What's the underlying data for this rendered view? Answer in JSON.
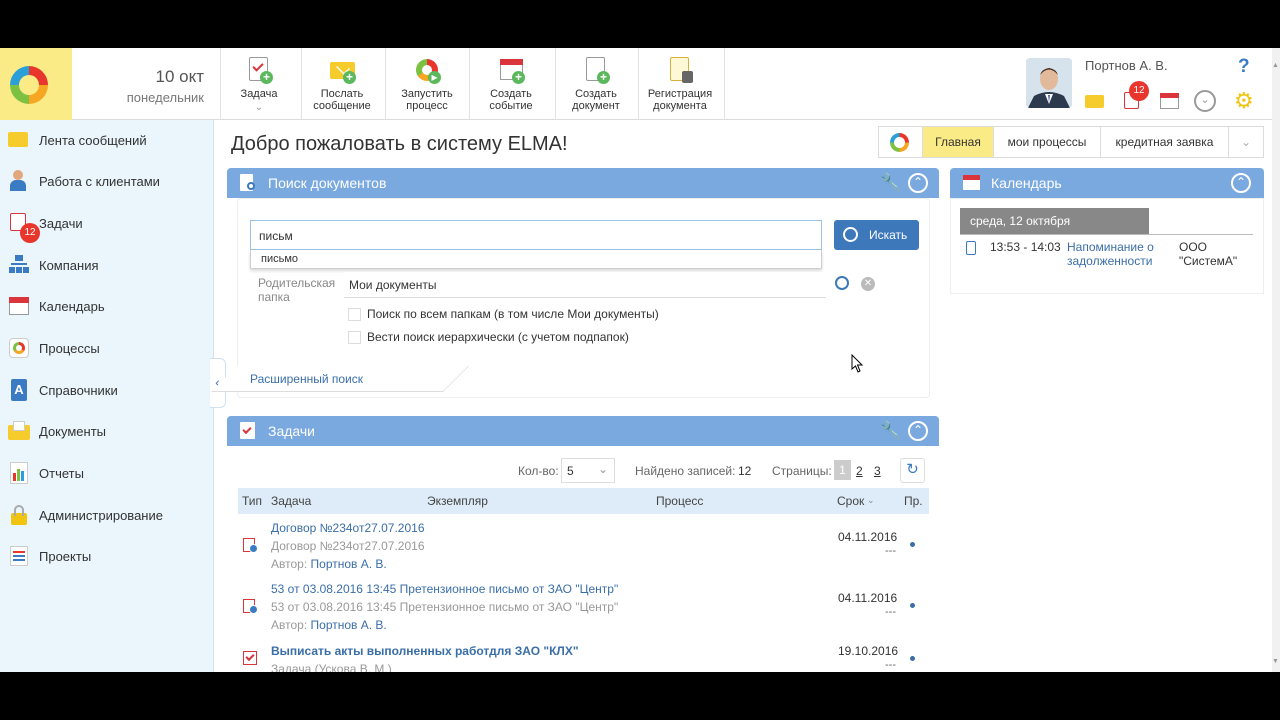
{
  "header": {
    "date_day": "10 окт",
    "date_weekday": "понедельник",
    "toolbar": [
      {
        "label": "Задача",
        "icon": "task-icon",
        "has_dropdown": true
      },
      {
        "label": "Послать сообщение",
        "icon": "envelope-icon"
      },
      {
        "label": "Запустить процесс",
        "icon": "process-icon"
      },
      {
        "label": "Создать событие",
        "icon": "calendar-icon"
      },
      {
        "label": "Создать документ",
        "icon": "document-icon"
      },
      {
        "label": "Регистрация документа",
        "icon": "register-document-icon"
      }
    ],
    "toolbar_labels": {
      "task_l1": "Задача",
      "msg_l1": "Послать",
      "msg_l2": "сообщение",
      "proc_l1": "Запустить",
      "proc_l2": "процесс",
      "event_l1": "Создать",
      "event_l2": "событие",
      "doc_l1": "Создать",
      "doc_l2": "документ",
      "reg_l1": "Регистрация",
      "reg_l2": "документа"
    },
    "user_name": "Портнов А. В.",
    "task_badge": "12",
    "help": "?"
  },
  "sidebar": {
    "items": [
      {
        "label": "Лента сообщений",
        "icon": "feed-icon"
      },
      {
        "label": "Работа с клиентами",
        "icon": "clients-icon"
      },
      {
        "label": "Задачи",
        "icon": "tasks-icon",
        "badge": "12"
      },
      {
        "label": "Компания",
        "icon": "company-icon"
      },
      {
        "label": "Календарь",
        "icon": "calendar-icon"
      },
      {
        "label": "Процессы",
        "icon": "processes-icon"
      },
      {
        "label": "Справочники",
        "icon": "catalogs-icon"
      },
      {
        "label": "Документы",
        "icon": "documents-icon"
      },
      {
        "label": "Отчеты",
        "icon": "reports-icon"
      },
      {
        "label": "Администрирование",
        "icon": "admin-icon"
      },
      {
        "label": "Проекты",
        "icon": "projects-icon"
      }
    ]
  },
  "main": {
    "title": "Добро пожаловать в систему ELMA!",
    "tabs": [
      {
        "label": "Главная",
        "active": true
      },
      {
        "label": "мои процессы"
      },
      {
        "label": "кредитная заявка"
      }
    ]
  },
  "search_panel": {
    "title": "Поиск документов",
    "query": "письм",
    "suggestion": "письмо",
    "search_button": "Искать",
    "folder_label": "Родительская папка",
    "folder_value": "Мои документы",
    "check_all_folders": "Поиск по всем папкам (в том числе Мои документы)",
    "check_hierarchical": "Вести поиск иерархически (с учетом подпапок)",
    "advanced_link": "Расширенный поиск"
  },
  "tasks_panel": {
    "title": "Задачи",
    "count_label": "Кол-во:",
    "count_value": "5",
    "found_label": "Найдено записей:",
    "found_value": "12",
    "pages_label": "Страницы:",
    "pages": [
      "1",
      "2",
      "3"
    ],
    "columns": [
      "Тип",
      "Задача",
      "Экземпляр",
      "Процесс",
      "Срок",
      "Пр."
    ],
    "rows": [
      {
        "title": "Договор №234от27.07.2016",
        "subtitle": "Договор №234от27.07.2016",
        "author_label": "Автор:",
        "author": "Портнов А. В.",
        "due": "04.11.2016",
        "dash": "---"
      },
      {
        "title": "53 от 03.08.2016 13:45 Претензионное письмо от ЗАО \"Центр\"",
        "subtitle": "53 от 03.08.2016 13:45 Претензионное письмо от ЗАО \"Центр\"",
        "author_label": "Автор:",
        "author": "Портнов А. В.",
        "due": "04.11.2016",
        "dash": "---"
      },
      {
        "title": "Выписать акты выполненных работдля ЗАО \"КЛХ\"",
        "subtitle": "Задача (Ускова В. М.)",
        "due": "19.10.2016",
        "dash": "---"
      }
    ]
  },
  "calendar_panel": {
    "title": "Календарь",
    "day": "среда, 12 октября",
    "events": [
      {
        "time": "13:53 - 14:03",
        "title_l1": "Напоминание о",
        "title_l2": "задолженности",
        "org_l1": "ООО",
        "org_l2": "\"СистемА\""
      }
    ]
  },
  "colors": {
    "accent": "#7aa9df",
    "sidebar_bg": "#eaf5fc",
    "logo_bg": "#fbeb86",
    "badge": "#e8362d",
    "button": "#3d78bb"
  }
}
